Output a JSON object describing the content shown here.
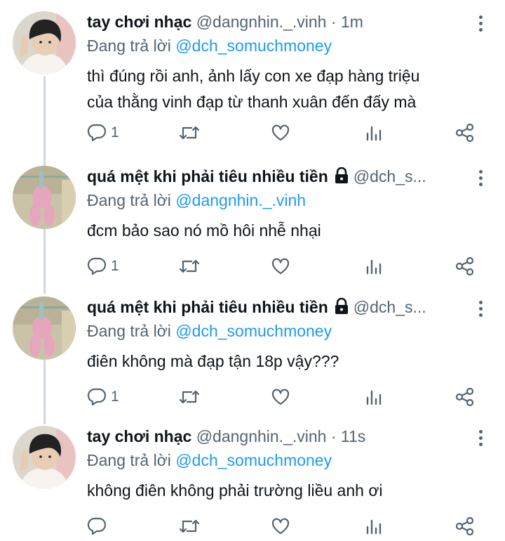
{
  "reply_prefix": "Đang trả lời",
  "tweets": [
    {
      "name": "tay chơi nhạc",
      "handle": "@dangnhin._.vinh",
      "sep": " · ",
      "time": "1m",
      "reply_to": "@dch_somuchmoney",
      "text_lines": [
        "thì đúng rồi anh, ảnh lấy con xe đạp hàng triệu",
        "của thằng vinh đạp từ thanh xuân đến đấy mà"
      ],
      "reply_count": "1",
      "locked": false,
      "avatar": "avatar-boy"
    },
    {
      "name": "quá mệt khi phải tiêu nhiều tiền",
      "handle": "@dch_s...",
      "sep": "",
      "time": "",
      "reply_to": "@dangnhin._.vinh",
      "text_lines": [
        "đcm bảo sao nó mồ hôi nhễ nhại"
      ],
      "reply_count": "1",
      "locked": true,
      "avatar": "avatar-pink-rabbit"
    },
    {
      "name": "quá mệt khi phải tiêu nhiều tiền",
      "handle": "@dch_s...",
      "sep": "",
      "time": "",
      "reply_to": "@dch_somuchmoney",
      "text_lines": [
        "điên không mà đạp tận 18p vậy???"
      ],
      "reply_count": "1",
      "locked": true,
      "avatar": "avatar-pink-rabbit"
    },
    {
      "name": "tay chơi nhạc",
      "handle": "@dangnhin._.vinh",
      "sep": " · ",
      "time": "11s",
      "reply_to": "@dch_somuchmoney",
      "text_lines": [
        "không điên không phải trường liều anh ơi"
      ],
      "reply_count": "",
      "locked": false,
      "avatar": "avatar-boy"
    }
  ],
  "icons": {
    "reply": "speech-bubble-icon",
    "retweet": "retweet-icon",
    "like": "heart-icon",
    "views": "bar-chart-icon",
    "share": "share-icon",
    "more": "more-vertical-icon",
    "lock": "lock-icon"
  },
  "colors": {
    "text": "#0f1419",
    "secondary": "#536471",
    "mention": "#1d9bf0",
    "thread_line": "#cfd9de"
  }
}
